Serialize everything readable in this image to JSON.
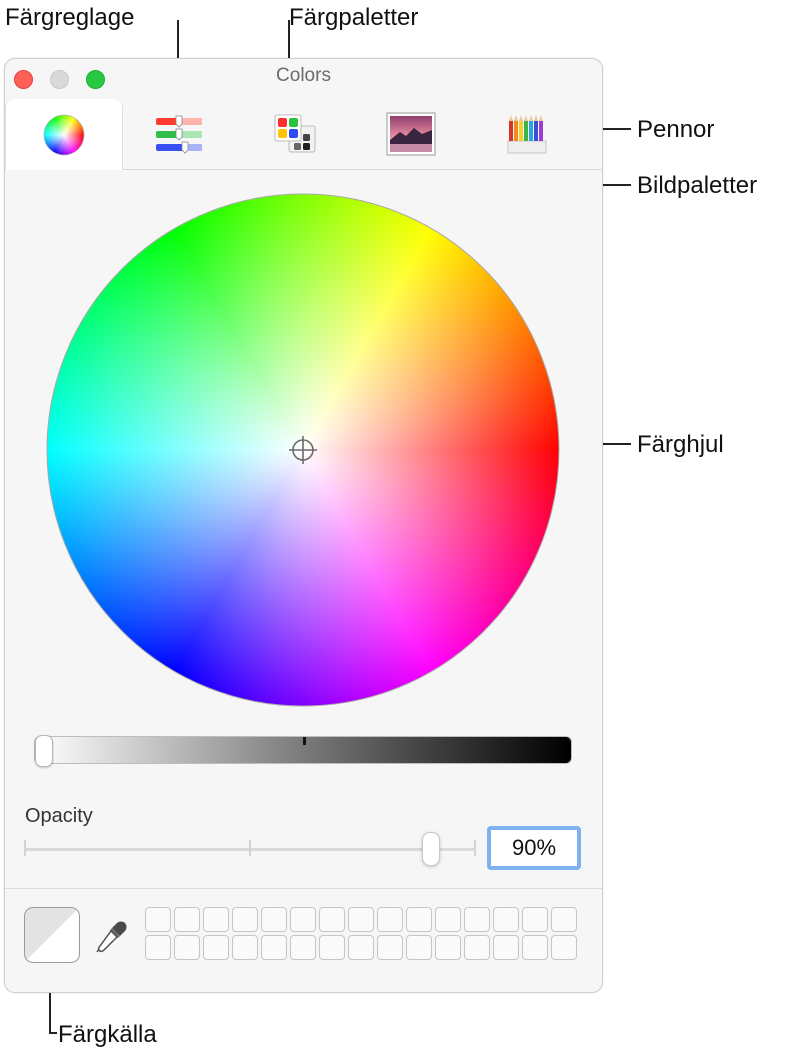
{
  "window": {
    "title": "Colors",
    "traffic_lights": [
      "close",
      "minimize",
      "zoom"
    ],
    "colors": {
      "close": "#fe5f57",
      "minimize": "#d9d9d9",
      "zoom": "#28c840",
      "focus_ring": "#7fb0ef"
    }
  },
  "toolbar": {
    "tabs": [
      {
        "id": "color-wheel",
        "icon": "color-wheel-icon",
        "selected": true
      },
      {
        "id": "color-sliders",
        "icon": "sliders-icon",
        "selected": false
      },
      {
        "id": "color-palettes",
        "icon": "palette-icon",
        "selected": false
      },
      {
        "id": "image-palettes",
        "icon": "image-icon",
        "selected": false
      },
      {
        "id": "pencils",
        "icon": "pencils-icon",
        "selected": false
      }
    ]
  },
  "brightness": {
    "value": 0.0
  },
  "opacity": {
    "label": "Opacity",
    "value_text": "90%",
    "value": 0.9
  },
  "swatches": {
    "rows": 2,
    "columns": 15
  },
  "annotations": {
    "fargreglage": "Färgreglage",
    "fargpaletter": "Färgpaletter",
    "pennor": "Pennor",
    "bildpaletter": "Bildpaletter",
    "farghjul": "Färghjul",
    "fargkalla": "Färgkälla"
  }
}
